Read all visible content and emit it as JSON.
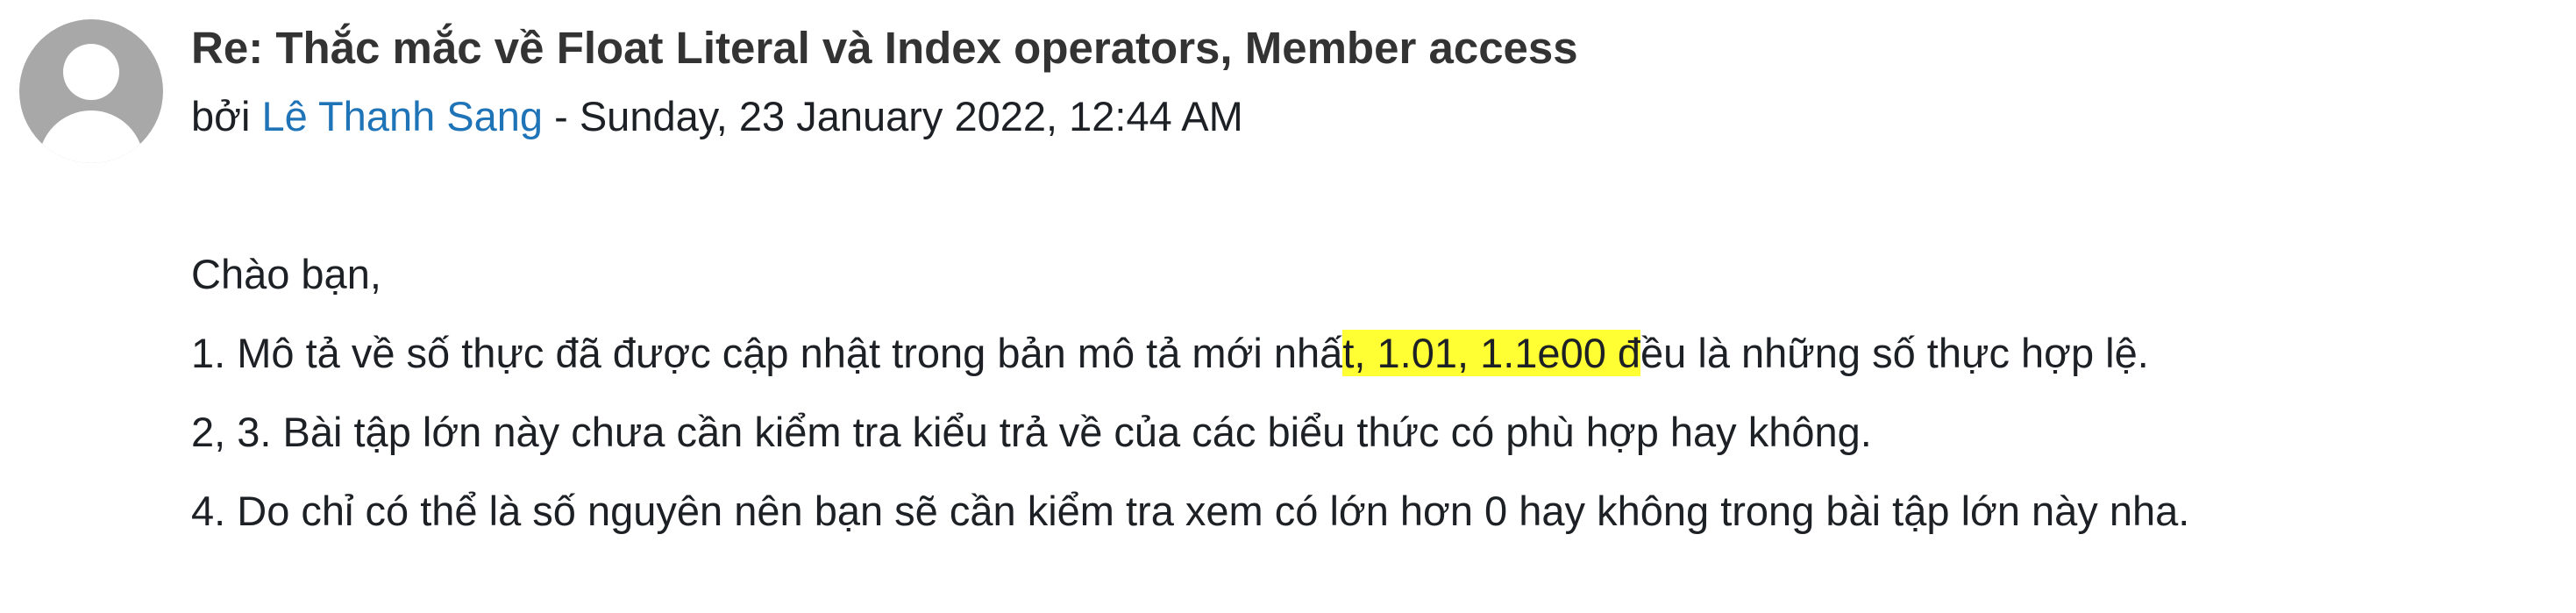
{
  "post": {
    "subject": "Re: Thắc mắc về Float Literal và Index operators, Member access",
    "by_prefix": "bởi ",
    "author": "Lê Thanh Sang",
    "date_separator": " - ",
    "date": "Sunday, 23 January 2022, 12:44 AM",
    "avatar_icon": "default-user-avatar-icon",
    "highlight_color": "#ffff33",
    "link_color": "#1f73b7"
  },
  "content": {
    "greeting": "Chào bạn,",
    "line1_before": "1. Mô tả về số thực đã được cập nhật trong bản mô tả mới nhấ",
    "line1_highlight": "t, 1.01, 1.1e00 đ",
    "line1_after": "ều là những số thực hợp lệ.",
    "line2": "2, 3. Bài tập lớn này chưa cần kiểm tra kiểu trả về của các biểu thức có phù hợp hay không.",
    "line3": "4. Do chỉ có thể là số nguyên nên bạn sẽ cần kiểm tra xem có lớn hơn 0 hay không trong bài tập lớn này nha."
  }
}
